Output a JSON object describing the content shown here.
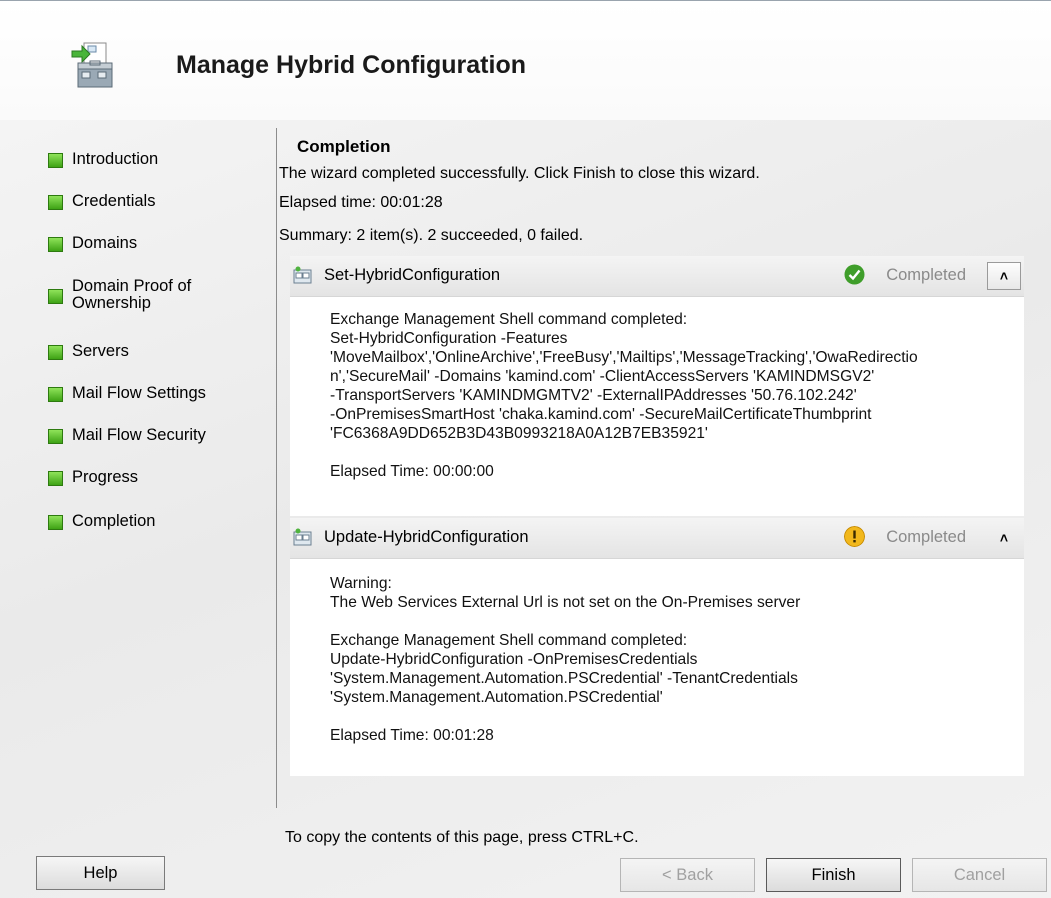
{
  "window": {
    "title": "Manage Hybrid Configuration",
    "icon": "wizard-toolbox-icon"
  },
  "nav": {
    "items": [
      {
        "label": "Introduction"
      },
      {
        "label": "Credentials"
      },
      {
        "label": "Domains"
      },
      {
        "label": "Domain Proof of Ownership"
      },
      {
        "label": "Servers"
      },
      {
        "label": "Mail Flow Settings"
      },
      {
        "label": "Mail Flow Security"
      },
      {
        "label": "Progress"
      },
      {
        "label": "Completion"
      }
    ],
    "indicator_color": "#4fc21f"
  },
  "content": {
    "section_title": "Completion",
    "message": "The wizard completed successfully. Click Finish to close this wizard.",
    "elapsed": "Elapsed time: 00:01:28",
    "summary": "Summary: 2 item(s). 2 succeeded, 0 failed."
  },
  "tasks": [
    {
      "name": "Set-HybridConfiguration",
      "status": "Completed",
      "status_icon": "success-check-icon",
      "body": [
        "Exchange Management Shell command completed:",
        "Set-HybridConfiguration -Features",
        "'MoveMailbox','OnlineArchive','FreeBusy','Mailtips','MessageTracking','OwaRedirectio",
        "n','SecureMail' -Domains 'kamind.com' -ClientAccessServers 'KAMINDMSGV2'",
        "-TransportServers 'KAMINDMGMTV2' -ExternalIPAddresses '50.76.102.242'",
        "-OnPremisesSmartHost 'chaka.kamind.com' -SecureMailCertificateThumbprint",
        "'FC6368A9DD652B3D43B0993218A0A12B7EB35921'"
      ],
      "elapsed": "Elapsed Time: 00:00:00"
    },
    {
      "name": "Update-HybridConfiguration",
      "status": "Completed",
      "status_icon": "warning-icon",
      "warning": [
        "Warning:",
        "The Web Services External Url is not set on the On-Premises server"
      ],
      "body": [
        "Exchange Management Shell command completed:",
        "Update-HybridConfiguration -OnPremisesCredentials",
        "'System.Management.Automation.PSCredential' -TenantCredentials",
        "'System.Management.Automation.PSCredential'"
      ],
      "elapsed": "Elapsed Time: 00:01:28"
    }
  ],
  "footer": {
    "copy_hint": "To copy the contents of this page, press CTRL+C.",
    "help_label": "Help",
    "back_label": "< Back",
    "finish_label": "Finish",
    "cancel_label": "Cancel"
  }
}
